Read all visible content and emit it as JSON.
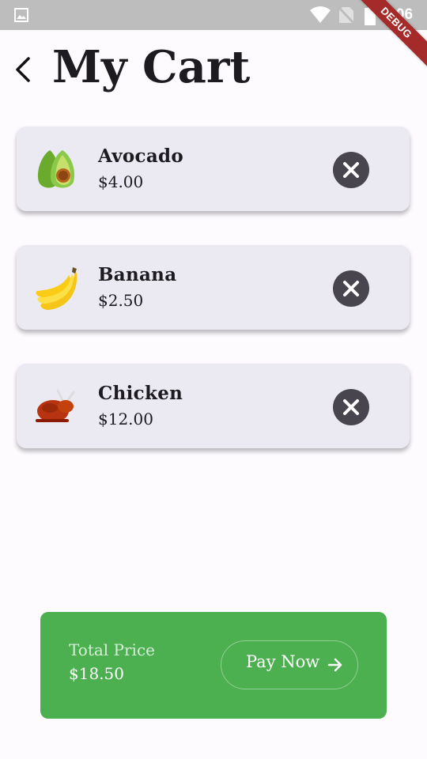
{
  "status_bar": {
    "time": "3:06",
    "debug_label": "DEBUG"
  },
  "header": {
    "title": "My Cart"
  },
  "cart": {
    "items": [
      {
        "name": "Avocado",
        "price": "$4.00",
        "icon": "avocado-icon"
      },
      {
        "name": "Banana",
        "price": "$2.50",
        "icon": "banana-icon"
      },
      {
        "name": "Chicken",
        "price": "$12.00",
        "icon": "chicken-icon"
      }
    ]
  },
  "checkout": {
    "total_label": "Total Price",
    "total_value": "$18.50",
    "pay_label": "Pay Now",
    "accent_color": "#4caf50"
  }
}
